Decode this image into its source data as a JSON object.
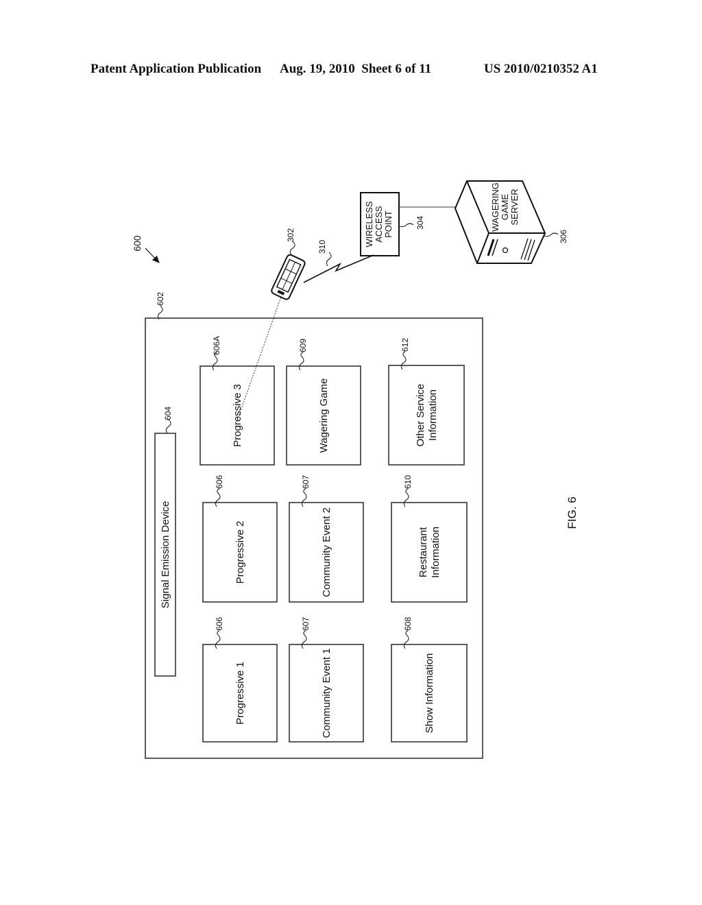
{
  "header": {
    "publication": "Patent Application Publication",
    "date_sheet": "Aug. 19, 2010  Sheet 6 of 11",
    "number": "US 2010/0210352 A1"
  },
  "figure": {
    "caption": "FIG. 6",
    "system_ref": "600",
    "display": {
      "ref": "602",
      "signal_device": {
        "label": "Signal Emission Device",
        "ref": "604"
      },
      "panels": [
        {
          "label": [
            "Progressive 1"
          ],
          "ref": "606"
        },
        {
          "label": [
            "Progressive 2"
          ],
          "ref": "606"
        },
        {
          "label": [
            "Progressive 3"
          ],
          "ref": "606A"
        },
        {
          "label": [
            "Community Event 1"
          ],
          "ref": "607"
        },
        {
          "label": [
            "Community Event 2"
          ],
          "ref": "607"
        },
        {
          "label": [
            "Wagering Game"
          ],
          "ref": "609"
        },
        {
          "label": [
            "Show Information"
          ],
          "ref": "608"
        },
        {
          "label": [
            "Restaurant",
            "Information"
          ],
          "ref": "610"
        },
        {
          "label": [
            "Other Service",
            "Information"
          ],
          "ref": "612"
        }
      ]
    },
    "mobile_device": {
      "ref": "302"
    },
    "wireless_link": {
      "ref": "310"
    },
    "access_point": {
      "label": [
        "WIRELESS",
        "ACCESS",
        "POINT"
      ],
      "ref": "304"
    },
    "server": {
      "label": [
        "WAGERING",
        "GAME",
        "SERVER"
      ],
      "ref": "306"
    }
  }
}
